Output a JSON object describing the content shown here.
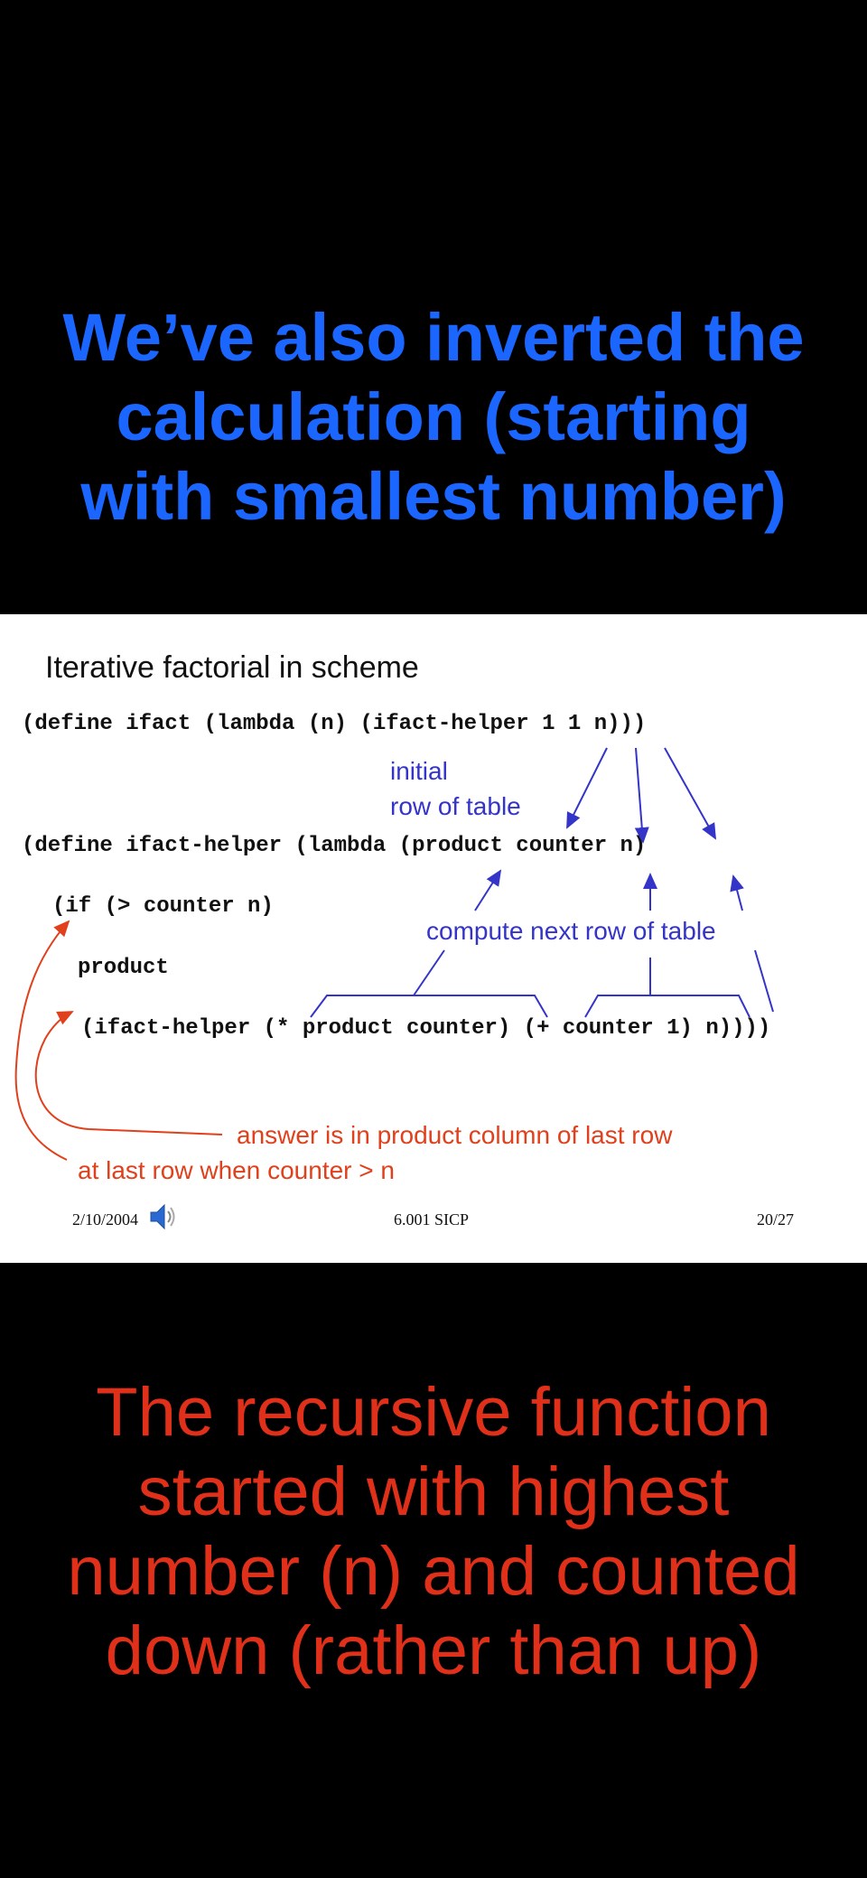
{
  "header": {
    "lines": [
      "We’ve also inverted the",
      "calculation (starting",
      "with smallest number)"
    ]
  },
  "slide": {
    "title": "Iterative factorial in scheme",
    "code": {
      "line1": "(define ifact (lambda (n) (ifact-helper 1 1 n)))",
      "line2": "(define ifact-helper (lambda (product counter n)",
      "line3": "(if (> counter n)",
      "line4": "product",
      "line5": "(ifact-helper (* product counter) (+ counter 1) n))))"
    },
    "annotations": {
      "initial_1": "initial",
      "initial_2": "row of table",
      "compute": "compute next row of table",
      "answer": "answer is in product column of last row",
      "last_row": "at last row when counter > n"
    },
    "footer": {
      "date": "2/10/2004",
      "course": "6.001 SICP",
      "page": "20/27"
    },
    "icons": [
      "speaker-icon"
    ],
    "colors": {
      "annotation_blue": "#3434c8",
      "annotation_red": "#e0401c"
    }
  },
  "footer_text": {
    "lines": [
      "The recursive function",
      "started with highest",
      "number (n) and counted",
      "down (rather than up)"
    ]
  }
}
